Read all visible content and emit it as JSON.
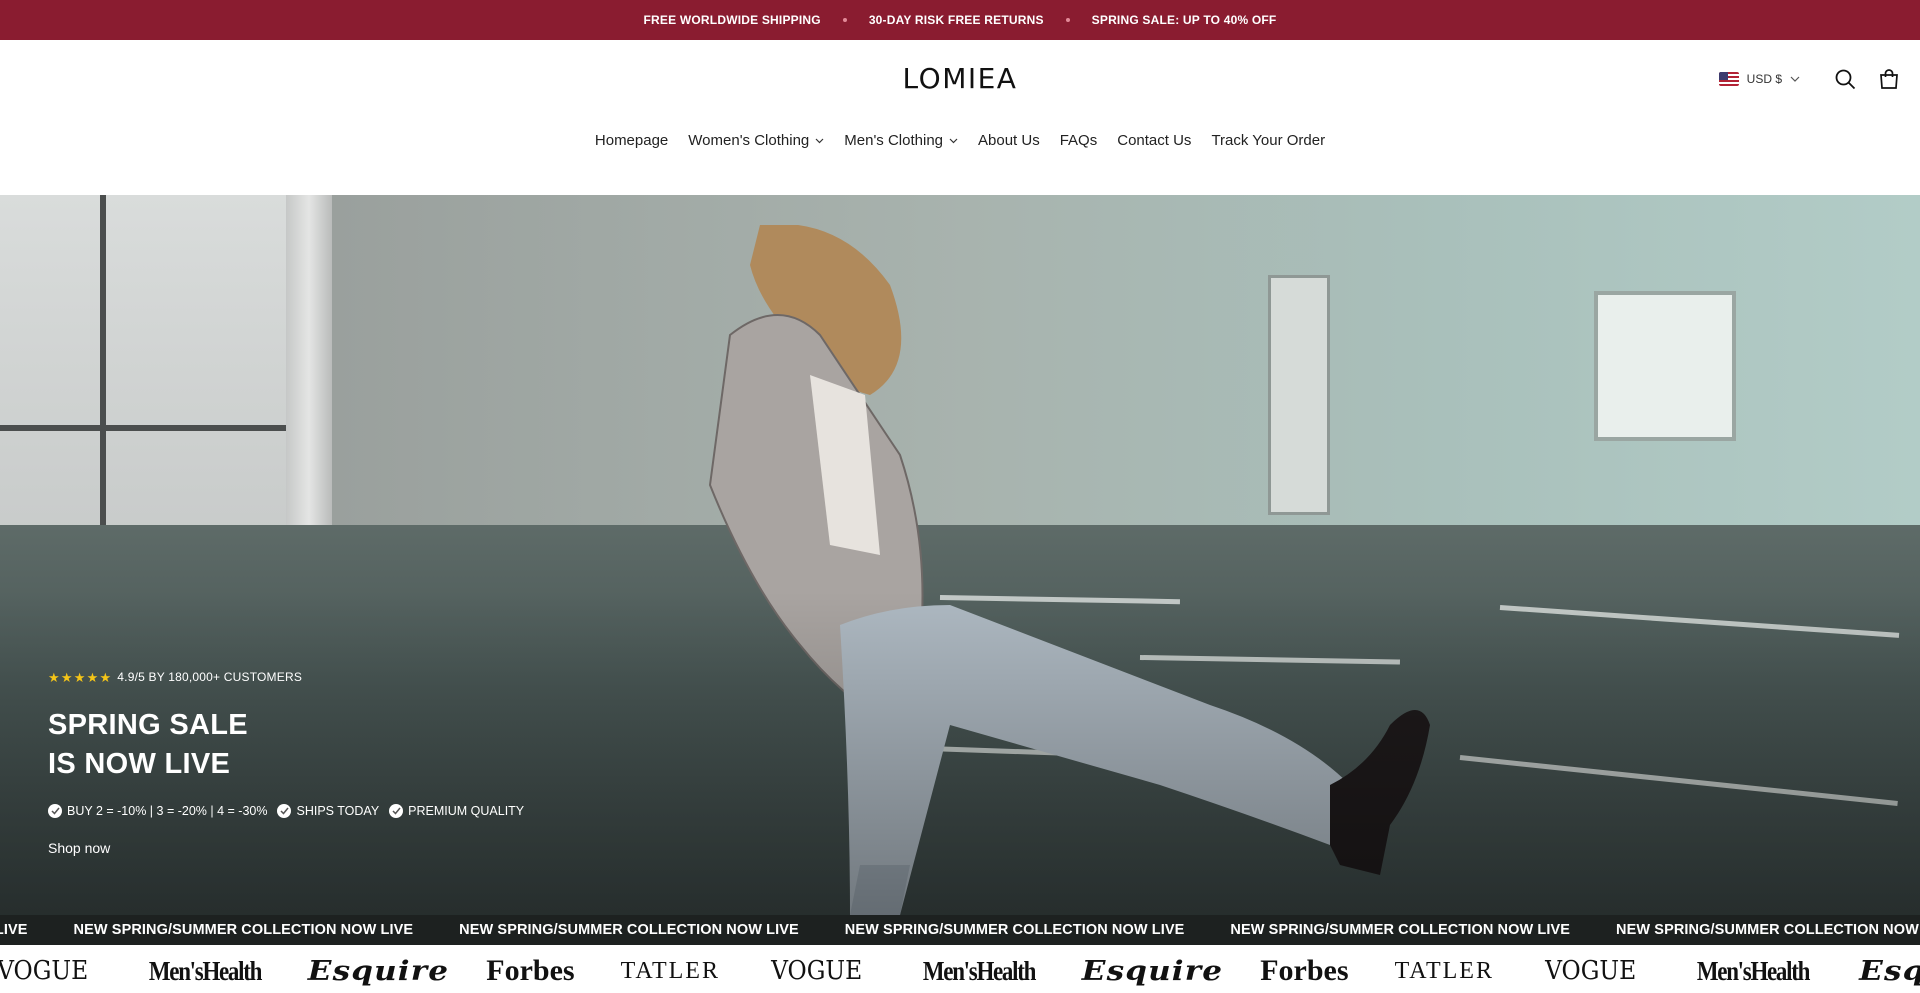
{
  "announcement": {
    "messages": [
      "FREE WORLDWIDE SHIPPING",
      "30-DAY RISK FREE RETURNS",
      "SPRING SALE: UP TO 40% OFF"
    ]
  },
  "header": {
    "logo": "LOMIEA",
    "currency": "USD $"
  },
  "nav": {
    "items": [
      {
        "label": "Homepage",
        "has_dropdown": false
      },
      {
        "label": "Women's Clothing",
        "has_dropdown": true
      },
      {
        "label": "Men's Clothing",
        "has_dropdown": true
      },
      {
        "label": "About Us",
        "has_dropdown": false
      },
      {
        "label": "FAQs",
        "has_dropdown": false
      },
      {
        "label": "Contact Us",
        "has_dropdown": false
      },
      {
        "label": "Track Your Order",
        "has_dropdown": false
      }
    ]
  },
  "hero": {
    "rating_text": "4.9/5 BY 180,000+ CUSTOMERS",
    "rating_stars": 5,
    "title_line1": "SPRING SALE",
    "title_line2": "IS NOW LIVE",
    "features": [
      "BUY 2 = -10% | 3 = -20% | 4 = -30%",
      "SHIPS TODAY",
      "PREMIUM QUALITY"
    ],
    "cta": "Shop now"
  },
  "marquee": {
    "lead_fragment": "W LIVE",
    "text": "NEW SPRING/SUMMER COLLECTION NOW LIVE"
  },
  "press": {
    "logos": [
      "VOGUE",
      "Men'sHealth",
      "Esquire",
      "Forbes",
      "TATLER",
      "VOGUE",
      "Men'sHealth",
      "Esquire",
      "Forbes",
      "TATLER",
      "VOGUE",
      "Men'sHealth",
      "Esqu"
    ]
  },
  "colors": {
    "announcement_bg": "#8a1c30",
    "marquee_bg": "#1d2120",
    "star": "#f5c518"
  }
}
